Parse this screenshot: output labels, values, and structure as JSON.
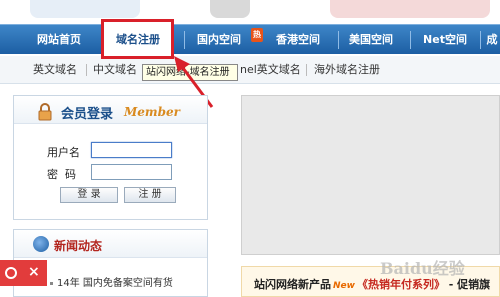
{
  "nav": {
    "items": [
      "网站首页",
      "域名注册",
      "国内空间",
      "香港空间",
      "美国空间",
      "Net空间",
      "成"
    ],
    "hot_badge": "热"
  },
  "subnav": {
    "items": [
      "英文域名",
      "中文域名",
      "nel英文域名",
      "海外域名注册"
    ]
  },
  "tooltip": "站闪网络-域名注册",
  "login": {
    "title": "会员登录",
    "subtitle": "Member",
    "username_label": "用户名",
    "password_label": "密  码",
    "username_value": "",
    "password_value": "",
    "login_button": "登 录",
    "register_button": "注 册"
  },
  "news": {
    "title": "新闻动态",
    "items": [
      "14年 国内免备案空间有货"
    ]
  },
  "promo": {
    "prefix": "站闪网络新产品",
    "badge": "New",
    "highlight": "《热销年付系列》",
    "suffix": " - 促销旗"
  },
  "watermark": "Baidu经验",
  "colors": {
    "nav_bg": "#1c5ea3",
    "highlight_border": "#d9202a",
    "login_title": "#1b4f8a",
    "member_accent": "#d98a1f",
    "news_title": "#b3251e"
  }
}
